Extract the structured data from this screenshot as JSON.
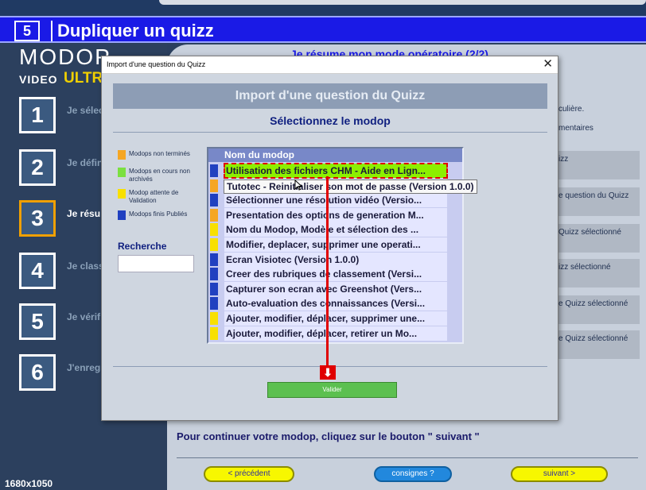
{
  "banner": {
    "number": "5",
    "title": "Dupliquer un quizz"
  },
  "logo": {
    "brand": "MODOP",
    "video": "VIDEO",
    "ultra": "ULTR"
  },
  "steps": [
    {
      "num": "1",
      "label": "Je sélec mes film"
    },
    {
      "num": "2",
      "label": "Je défin opératio"
    },
    {
      "num": "3",
      "label": "Je résu mode o"
    },
    {
      "num": "4",
      "label": "Je class mode o"
    },
    {
      "num": "5",
      "label": "Je vérif mode o"
    },
    {
      "num": "6",
      "label": "J'enreg mode o"
    }
  ],
  "resolution": "1680x1050",
  "background_page": {
    "title": "Je résume mon mode opératoire (2/2)",
    "notes": [
      "culière.",
      "mentaires"
    ],
    "right_items": [
      "izz",
      "e question du Quizz",
      "Quizz sélectionné",
      "izz sélectionné",
      "e Quizz sélectionné",
      "e Quizz sélectionné"
    ],
    "bottom_text": "Pour continuer votre modop, cliquez sur le bouton \" suivant \"",
    "nav": {
      "prev": "< précédent",
      "consignes": "consignes ?",
      "next": "suivant >"
    }
  },
  "dialog": {
    "window_title": "Import d'une question du Quizz",
    "close": "✕",
    "header": "Import d'une question du Quizz",
    "subtitle": "Sélectionnez le modop",
    "legend": [
      {
        "label": "Modops non terminés",
        "color": "#f5a623"
      },
      {
        "label": "Modops en cours non archivés",
        "color": "#7be040"
      },
      {
        "label": "Modop attente de Validation",
        "color": "#f8e000"
      },
      {
        "label": "Modops finis Publiés",
        "color": "#2040c0"
      }
    ],
    "search_label": "Recherche",
    "search_value": "",
    "list_header": "Nom du modop",
    "rows": [
      {
        "text": "Utilisation des fichiers CHM - Aide en Lign...",
        "color": "#2040c0",
        "selected": true
      },
      {
        "text": "Tutotec - Réinitialiser son mot de passe (Version 1.0.0)",
        "color": "#f5a623"
      },
      {
        "text": "Sélectionner une résolution vidéo (Versio...",
        "color": "#2040c0"
      },
      {
        "text": "Presentation des options de generation M...",
        "color": "#f5a623"
      },
      {
        "text": "Nom du Modop, Modèle et sélection des ...",
        "color": "#f8e000"
      },
      {
        "text": "Modifier, deplacer, supprimer une operati...",
        "color": "#f8e000"
      },
      {
        "text": "Ecran Visiotec (Version 1.0.0)",
        "color": "#2040c0"
      },
      {
        "text": "Creer des rubriques de classement (Versi...",
        "color": "#2040c0"
      },
      {
        "text": "Capturer son ecran avec Greenshot (Vers...",
        "color": "#2040c0"
      },
      {
        "text": "Auto-evaluation des connaissances (Versi...",
        "color": "#2040c0"
      },
      {
        "text": "Ajouter, modifier, déplacer, supprimer une...",
        "color": "#f8e000"
      },
      {
        "text": "Ajouter, modifier, déplacer, retirer un Mo...",
        "color": "#f8e000"
      }
    ],
    "tooltip": "Tutotec - Reinitialiser son mot de passe (Version 1.0.0)",
    "validate": "Valider"
  }
}
